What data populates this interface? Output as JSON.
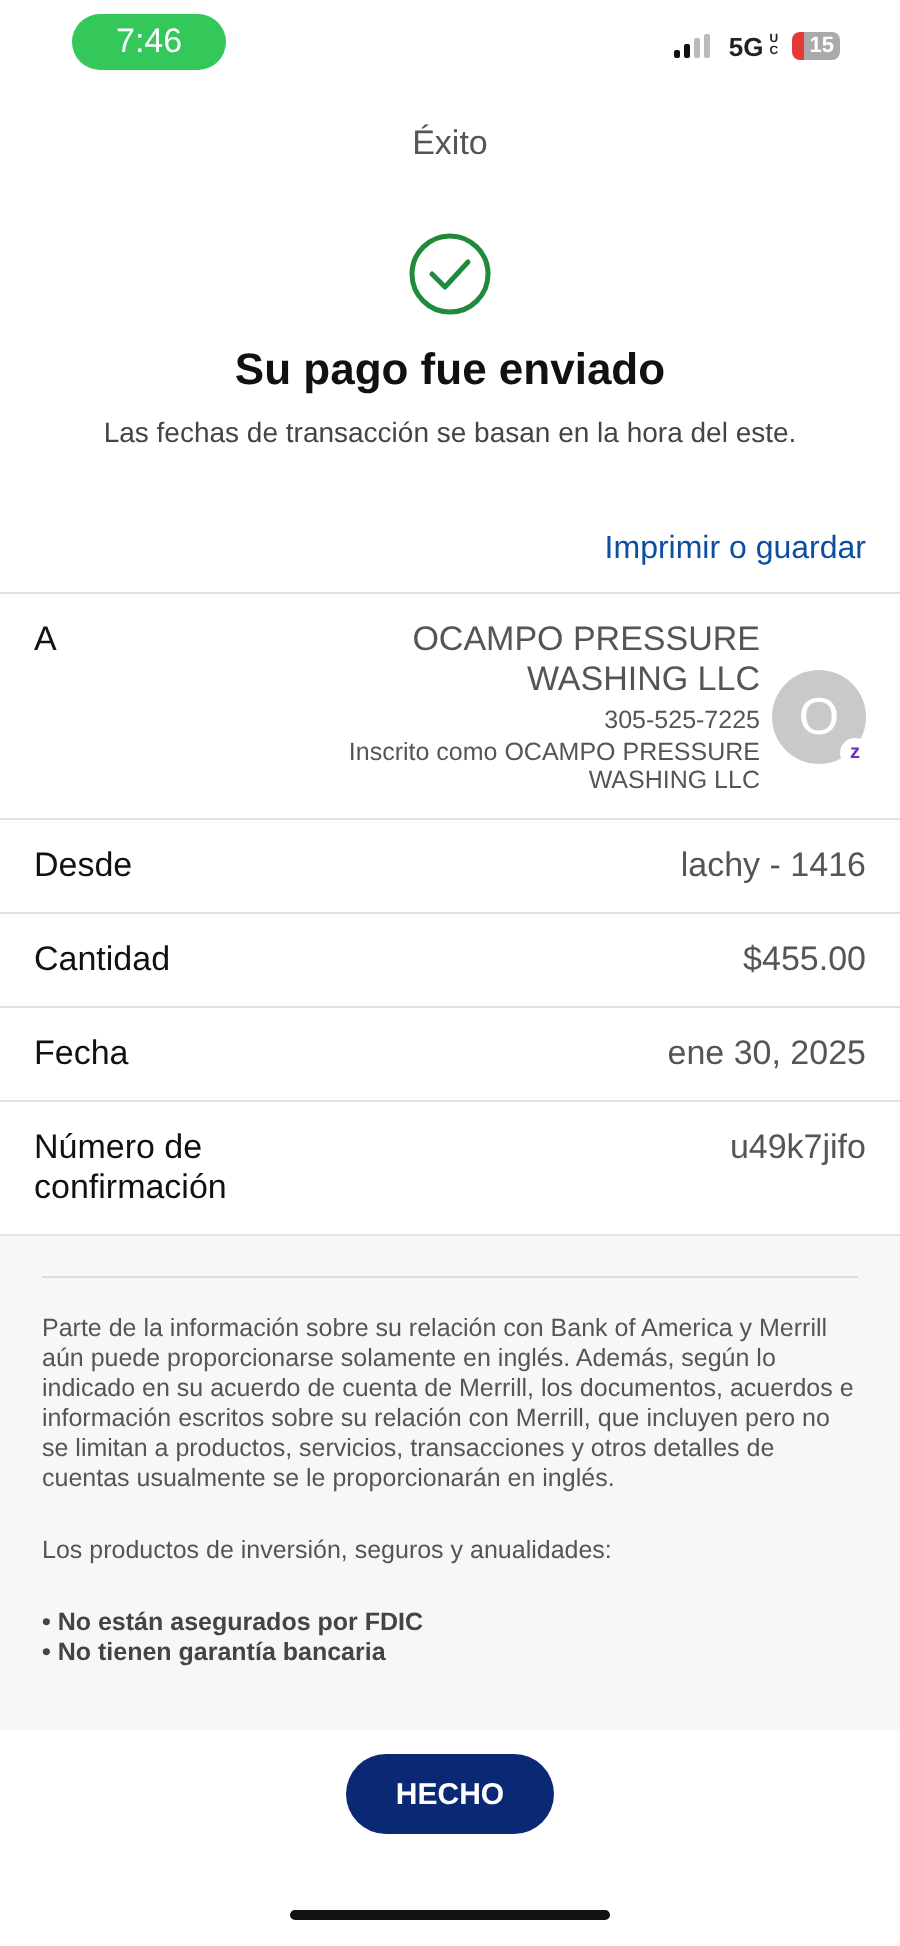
{
  "status_bar": {
    "time": "7:46",
    "network": "5G",
    "network_sub": "UC",
    "battery": "15"
  },
  "header": {
    "title": "Éxito"
  },
  "confirmation": {
    "heading": "Su pago fue enviado",
    "subtitle": "Las fechas de transacción se basan en la hora del este."
  },
  "print_link": "Imprimir o guardar",
  "recipient": {
    "label": "A",
    "name": "OCAMPO PRESSURE WASHING LLC",
    "phone": "305-525-7225",
    "enrolled": "Inscrito como OCAMPO PRESSURE WASHING LLC",
    "avatar": "O",
    "badge": "z"
  },
  "details": [
    {
      "label": "Desde",
      "value": "lachy - 1416"
    },
    {
      "label": "Cantidad",
      "value": "$455.00"
    },
    {
      "label": "Fecha",
      "value": "ene 30, 2025"
    },
    {
      "label": "Número de confirmación",
      "value": "u49k7jifo"
    }
  ],
  "disclosure": {
    "paragraph": "Parte de la información sobre su relación con Bank of America y Merrill aún puede proporcionarse solamente en inglés. Además, según lo indicado en su acuerdo de cuenta de Merrill, los documentos, acuerdos e información escritos sobre su relación con Merrill, que incluyen pero no se limitan a productos, servicios, transacciones y otros detalles de cuentas usualmente se le proporcionarán en inglés.",
    "intro": "Los productos de inversión, seguros y anualidades:",
    "bullets": [
      "• No están asegurados por FDIC",
      "• No tienen garantía bancaria"
    ]
  },
  "done_button": "HECHO"
}
